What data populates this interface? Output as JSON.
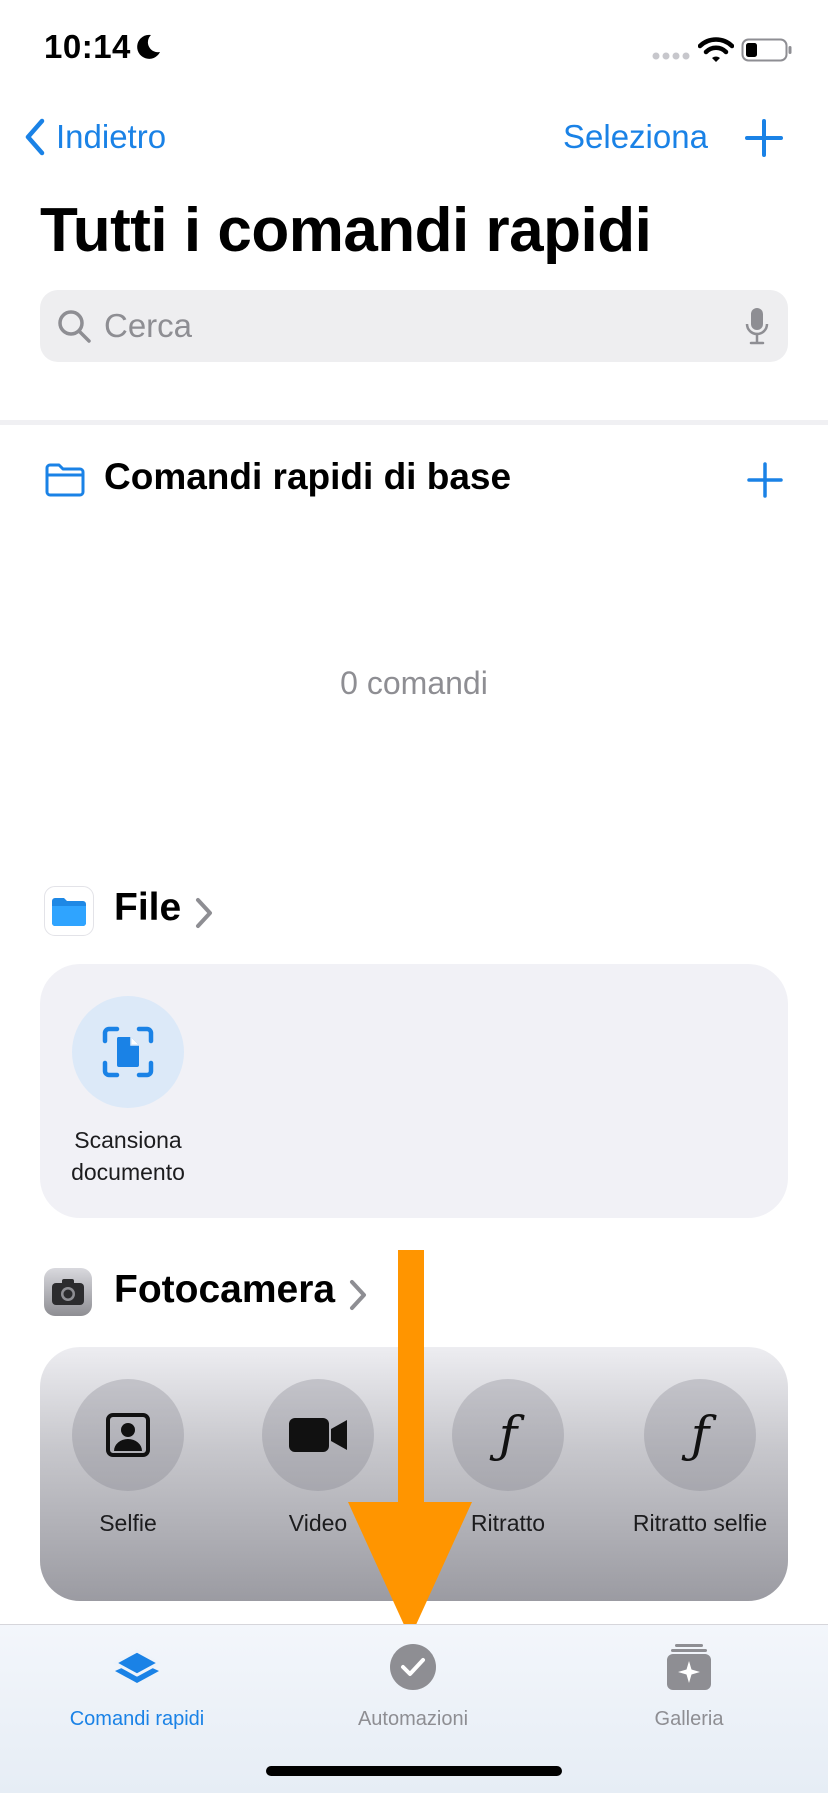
{
  "status_bar": {
    "time": "10:14"
  },
  "nav": {
    "back_label": "Indietro",
    "select_label": "Seleziona"
  },
  "page": {
    "title": "Tutti i comandi rapidi"
  },
  "search": {
    "placeholder": "Cerca"
  },
  "folder": {
    "title": "Comandi rapidi di base",
    "empty_text": "0 comandi"
  },
  "sections": {
    "files": {
      "title": "File",
      "actions": [
        {
          "label": "Scansiona documento",
          "icon": "scan-document-icon"
        }
      ]
    },
    "camera": {
      "title": "Fotocamera",
      "actions": [
        {
          "label": "Selfie",
          "icon": "selfie-icon"
        },
        {
          "label": "Video",
          "icon": "video-camera-icon"
        },
        {
          "label": "Ritratto",
          "icon": "f-aperture-icon"
        },
        {
          "label": "Ritratto selfie",
          "icon": "f-aperture-icon"
        }
      ]
    }
  },
  "tabbar": {
    "tabs": [
      {
        "label": "Comandi rapidi",
        "active": true
      },
      {
        "label": "Automazioni",
        "active": false
      },
      {
        "label": "Galleria",
        "active": false
      }
    ]
  },
  "colors": {
    "accent": "#1a82e6",
    "arrow": "#ff9500",
    "inactive_tab": "#8e8e93"
  }
}
